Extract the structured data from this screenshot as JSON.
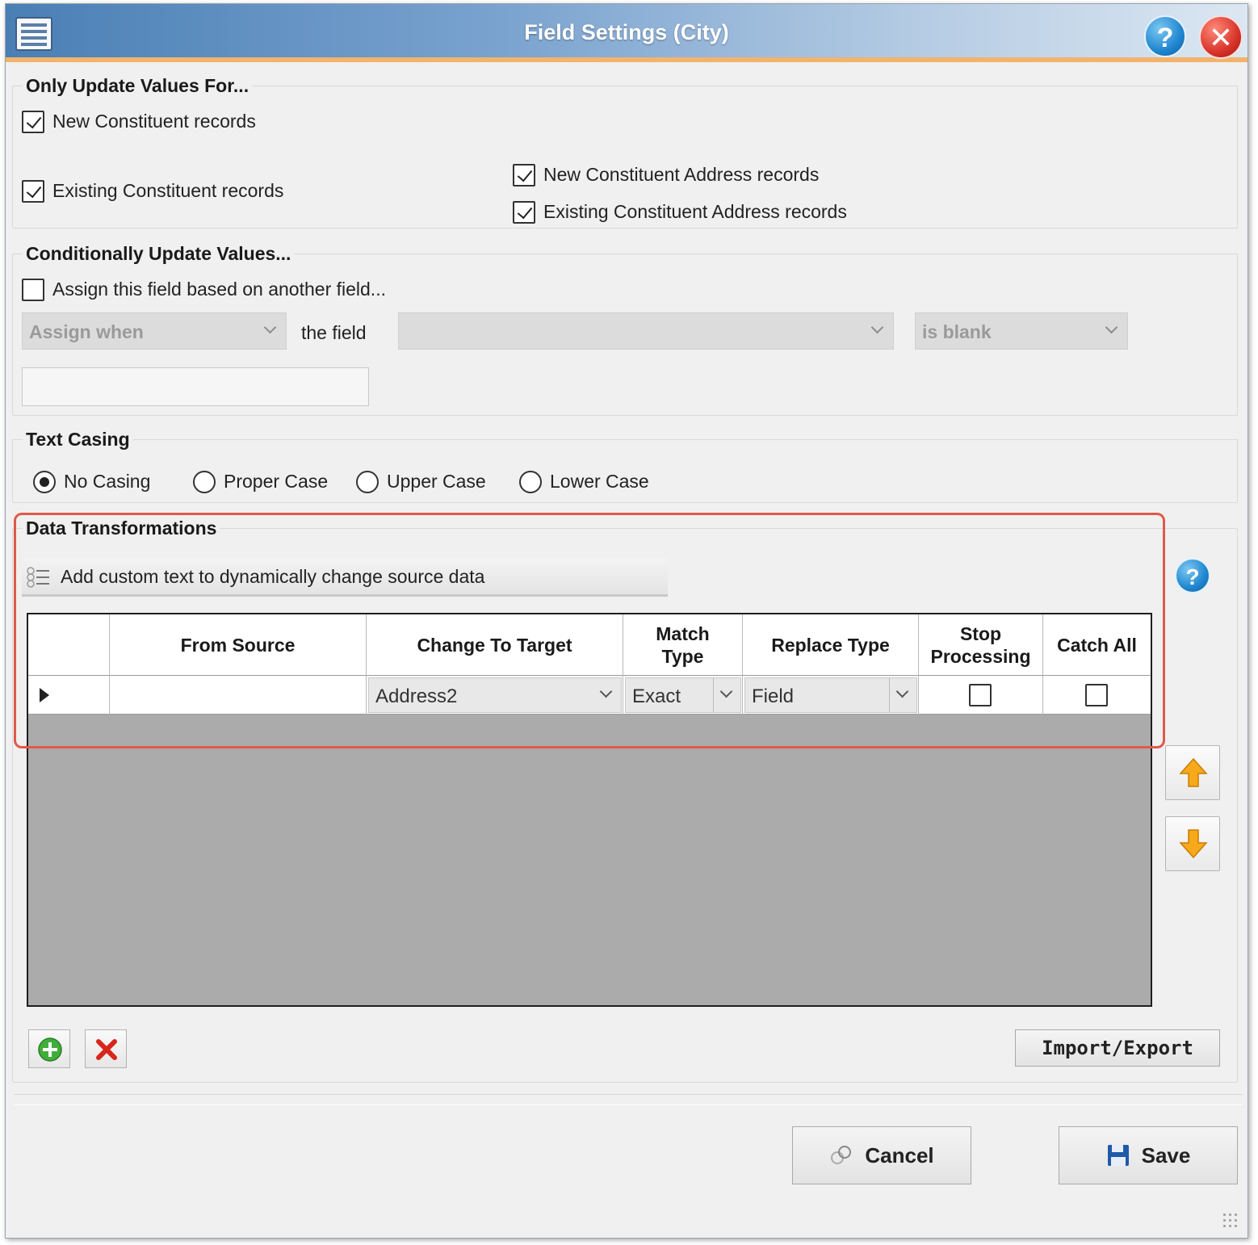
{
  "window": {
    "title": "Field Settings (City)",
    "help_icon": "help-icon",
    "close_icon": "close-icon",
    "app_icon": "table-icon"
  },
  "only_update": {
    "legend": "Only Update Values For...",
    "new_constituent": {
      "label": "New Constituent records",
      "checked": true
    },
    "existing_constituent": {
      "label": "Existing Constituent records",
      "checked": true
    },
    "new_address": {
      "label": "New Constituent Address records",
      "checked": true
    },
    "existing_address": {
      "label": "Existing Constituent Address records",
      "checked": true
    }
  },
  "conditional": {
    "legend": "Conditionally Update Values...",
    "assign_checkbox": {
      "label": "Assign this field based on another field...",
      "checked": false
    },
    "assign_when": "Assign when",
    "the_field_label": "the field",
    "field_select": "",
    "condition": "is blank",
    "value": ""
  },
  "text_casing": {
    "legend": "Text Casing",
    "options": [
      "No Casing",
      "Proper Case",
      "Upper Case",
      "Lower Case"
    ],
    "selected": "No Casing"
  },
  "data_transformations": {
    "legend": "Data Transformations",
    "add_custom_text": "Add custom text to dynamically change source data",
    "columns": {
      "from_source": "From Source",
      "change_to_target": "Change To Target",
      "match_type_1": "Match",
      "match_type_2": "Type",
      "replace_type": "Replace Type",
      "stop_processing_1": "Stop",
      "stop_processing_2": "Processing",
      "catch_all": "Catch All"
    },
    "rows": [
      {
        "from_source": "",
        "change_to_target": "Address2",
        "match_type": "Exact",
        "replace_type": "Field",
        "stop_processing": false,
        "catch_all": false
      }
    ],
    "import_export": "Import/Export"
  },
  "footer": {
    "cancel": "Cancel",
    "save": "Save"
  },
  "colors": {
    "title_gradient_start": "#4a7fb5",
    "title_accent_border": "#f3b36b",
    "highlight_border": "#e05a4a",
    "grid_empty": "#ababab",
    "arrow_yellow": "#f6a91a"
  }
}
